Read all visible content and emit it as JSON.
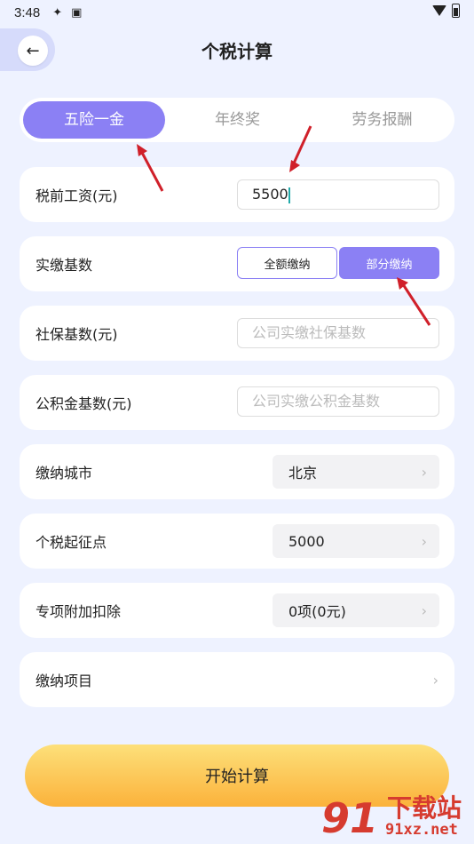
{
  "status_bar": {
    "time": "3:48"
  },
  "header": {
    "title": "个税计算"
  },
  "tabs": [
    {
      "label": "五险一金",
      "active": true
    },
    {
      "label": "年终奖",
      "active": false
    },
    {
      "label": "劳务报酬",
      "active": false
    }
  ],
  "salary": {
    "label": "税前工资(元)",
    "value": "5500"
  },
  "base": {
    "label": "实缴基数",
    "options": [
      "全额缴纳",
      "部分缴纳"
    ],
    "selected": "部分缴纳"
  },
  "social": {
    "label": "社保基数(元)",
    "placeholder": "公司实缴社保基数"
  },
  "fund": {
    "label": "公积金基数(元)",
    "placeholder": "公司实缴公积金基数"
  },
  "city": {
    "label": "缴纳城市",
    "value": "北京"
  },
  "threshold": {
    "label": "个税起征点",
    "value": "5000"
  },
  "deduction": {
    "label": "专项附加扣除",
    "value": "0项(0元)"
  },
  "items": {
    "label": "缴纳项目"
  },
  "actions": {
    "start": "开始计算"
  },
  "watermark": {
    "text": "下载站",
    "url": "91xz.net"
  },
  "colors": {
    "accent": "#8b80f4",
    "button_top": "#fde07a",
    "button_bottom": "#fbb23b",
    "arrow": "#d0202a"
  }
}
